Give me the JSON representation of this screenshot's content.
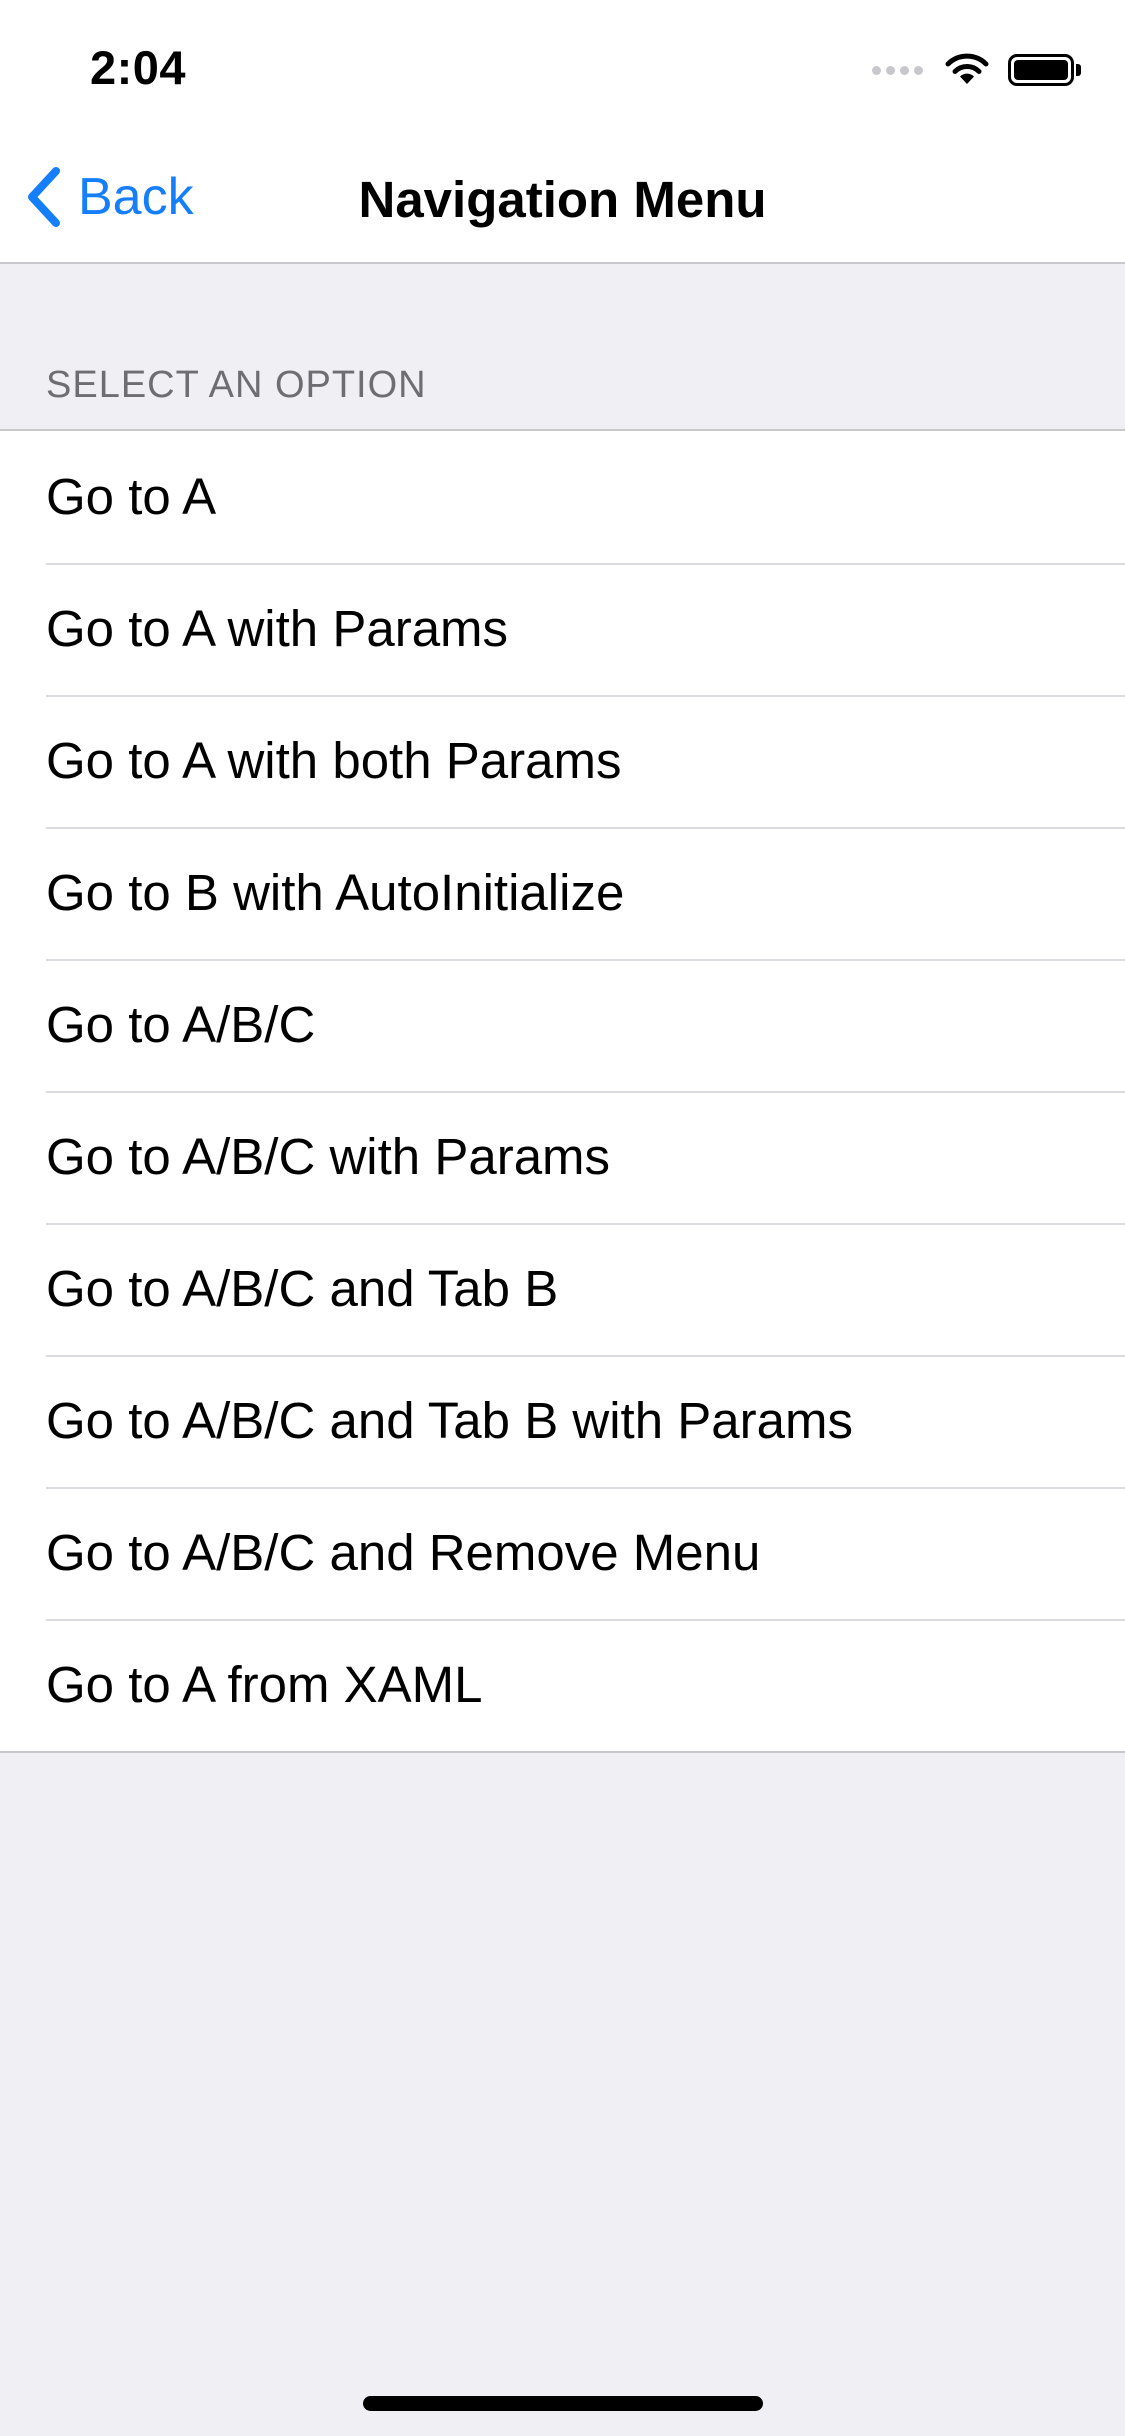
{
  "status_bar": {
    "time": "2:04",
    "icons": [
      "signal-icon",
      "wifi-icon",
      "battery-icon"
    ]
  },
  "nav_bar": {
    "back_label": "Back",
    "title": "Navigation Menu",
    "accent_color": "#147EFB"
  },
  "section": {
    "header": "SELECT AN OPTION"
  },
  "menu": {
    "items": [
      "Go to A",
      "Go to A with Params",
      "Go to A with both Params",
      "Go to B with AutoInitialize",
      "Go to A/B/C",
      "Go to A/B/C with Params",
      "Go to A/B/C and Tab B",
      "Go to A/B/C and Tab B with Params",
      "Go to A/B/C and Remove Menu",
      "Go to A from XAML"
    ]
  },
  "colors": {
    "background": "#EFEFF4",
    "surface": "#FFFFFF",
    "separator": "#C8C7CC",
    "section_header_text": "#6D6D72"
  }
}
